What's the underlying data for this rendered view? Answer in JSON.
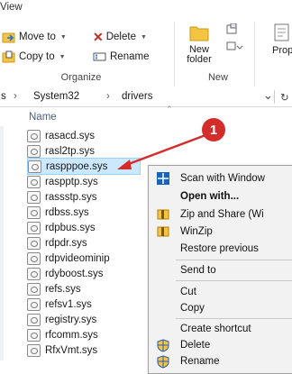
{
  "ribbon": {
    "tab_view": "View",
    "move_to": "Move to",
    "copy_to": "Copy to",
    "delete": "Delete",
    "rename": "Rename",
    "new_folder_line1": "New",
    "new_folder_line2": "folder",
    "properties_partial": "Prop",
    "group_organize": "Organize",
    "group_new": "New"
  },
  "address": {
    "crumb_start": "s",
    "crumb_system32": "System32",
    "crumb_drivers": "drivers",
    "chevron_down": "⌄",
    "refresh": "↻"
  },
  "file_list": {
    "column_name": "Name",
    "files": [
      "rasacd.sys",
      "rasl2tp.sys",
      "raspppoe.sys",
      "raspptp.sys",
      "rassstp.sys",
      "rdbss.sys",
      "rdpbus.sys",
      "rdpdr.sys",
      "rdpvideominip",
      "rdyboost.sys",
      "refs.sys",
      "refsv1.sys",
      "registry.sys",
      "rfcomm.sys",
      "RfxVmt.sys"
    ],
    "selected_index": 2
  },
  "context_menu": {
    "scan": "Scan with Window",
    "open_with": "Open with...",
    "zip_share": "Zip and Share (Wi",
    "winzip": "WinZip",
    "restore": "Restore previous",
    "send_to": "Send to",
    "cut": "Cut",
    "copy": "Copy",
    "create_shortcut": "Create shortcut",
    "delete": "Delete",
    "rename": "Rename"
  },
  "annotation": {
    "badge_number": "1"
  },
  "colors": {
    "selection": "#cce8ff",
    "annotation_red": "#d42b2b",
    "delete_red": "#c42b1c",
    "folder_yellow": "#f4c542"
  }
}
